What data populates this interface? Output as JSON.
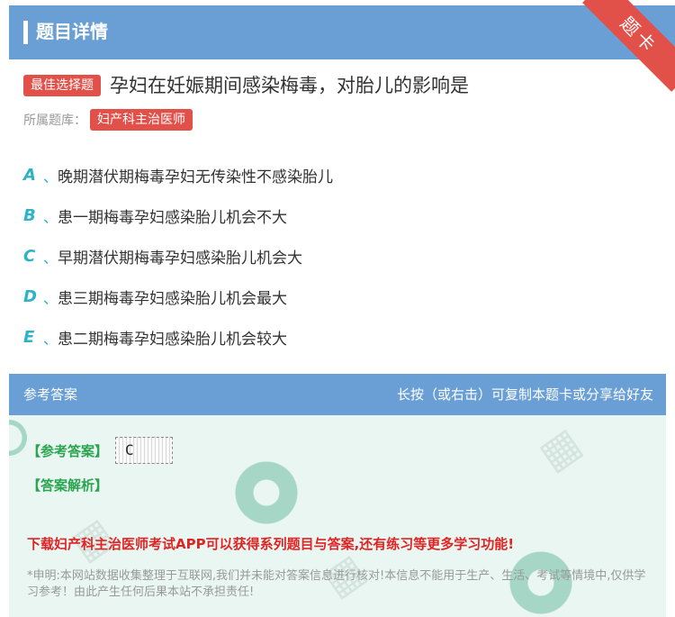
{
  "header": {
    "title": "题目详情",
    "corner_label": "题卡"
  },
  "question": {
    "type_badge": "最佳选择题",
    "text": "孕妇在妊娠期间感染梅毒，对胎儿的影响是",
    "bank_label": "所属题库：",
    "bank_name": "妇产科主治医师"
  },
  "options": [
    {
      "letter": "A",
      "sep": "、",
      "text": "晚期潜伏期梅毒孕妇无传染性不感染胎儿"
    },
    {
      "letter": "B",
      "sep": "、",
      "text": "患一期梅毒孕妇感染胎儿机会不大"
    },
    {
      "letter": "C",
      "sep": "、",
      "text": "早期潜伏期梅毒孕妇感染胎儿机会大"
    },
    {
      "letter": "D",
      "sep": "、",
      "text": "患三期梅毒孕妇感染胎儿机会最大"
    },
    {
      "letter": "E",
      "sep": "、",
      "text": "患二期梅毒孕妇感染胎儿机会较大"
    }
  ],
  "answer_section": {
    "title": "参考答案",
    "share_hint": "长按（或右击）可复制本题卡或分享给好友",
    "answer_label": "【参考答案】",
    "answer_value": "C",
    "analysis_label": "【答案解析】",
    "promo": "下载妇产科主治医师考试APP可以获得系列题目与答案,还有练习等更多学习功能!",
    "disclaimer": "*申明:本网站数据收集整理于互联网,我们并未能对答案信息进行核对!本信息不能用于生产、生活、考试等情境中,仅供学习参考！由此产生任何后果本站不承担责任!"
  },
  "colors": {
    "header_bg": "#6a9fd6",
    "accent_red": "#e2504a",
    "option_letter": "#2cb3c5",
    "answer_green": "#2aa44f",
    "promo_red": "#e02424",
    "answer_bg": "#e9f6f1"
  }
}
